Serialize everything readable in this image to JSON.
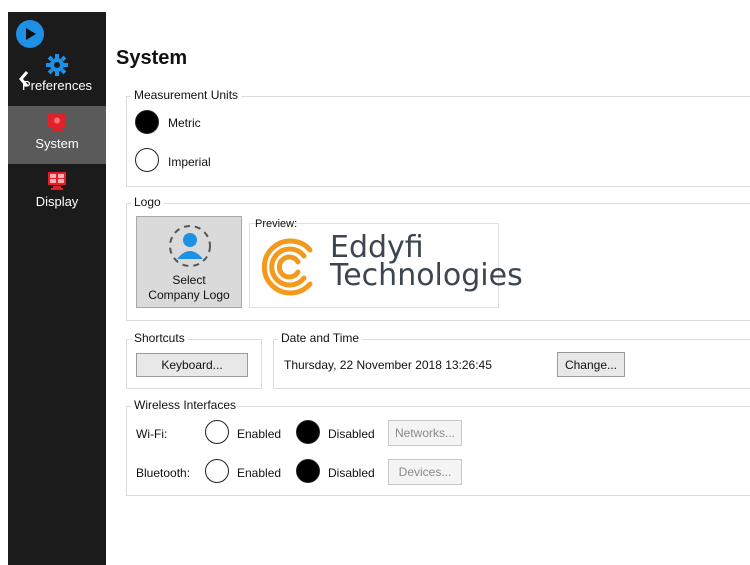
{
  "sidebar": {
    "items": [
      {
        "label": "Preferences",
        "icon": "gear-icon"
      },
      {
        "label": "System",
        "icon": "monitor-icon"
      },
      {
        "label": "Display",
        "icon": "display-icon"
      }
    ]
  },
  "page": {
    "title": "System"
  },
  "measurement": {
    "legend": "Measurement Units",
    "metric_label": "Metric",
    "imperial_label": "Imperial",
    "selected": "Metric"
  },
  "logo": {
    "legend": "Logo",
    "select_line1": "Select",
    "select_line2": "Company Logo",
    "preview_label": "Preview:",
    "brand_line1": "Eddyfi",
    "brand_line2": "Technologies"
  },
  "shortcuts": {
    "legend": "Shortcuts",
    "keyboard_button": "Keyboard..."
  },
  "datetime": {
    "legend": "Date and Time",
    "value": "Thursday, 22 November 2018 13:26:45",
    "change_button": "Change..."
  },
  "wireless": {
    "legend": "Wireless Interfaces",
    "wifi_label": "Wi-Fi:",
    "bluetooth_label": "Bluetooth:",
    "enabled_label": "Enabled",
    "disabled_label": "Disabled",
    "wifi_state": "Disabled",
    "bluetooth_state": "Disabled",
    "networks_button": "Networks...",
    "devices_button": "Devices..."
  },
  "colors": {
    "sidebar_bg": "#1b1b1b",
    "accent_blue": "#1e90e6",
    "active_item_bg": "#5a5a5a",
    "brand_orange": "#f39a1e"
  }
}
